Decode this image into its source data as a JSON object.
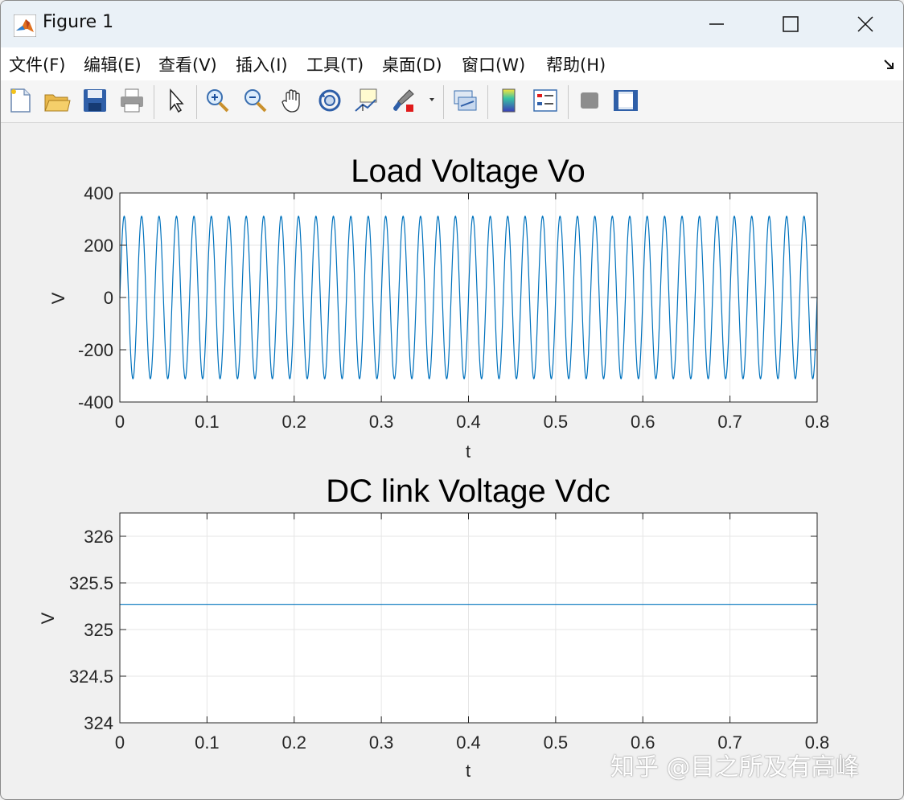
{
  "window": {
    "title": "Figure 1"
  },
  "menu": {
    "items": [
      "文件(F)",
      "编辑(E)",
      "查看(V)",
      "插入(I)",
      "工具(T)",
      "桌面(D)",
      "窗口(W)",
      "帮助(H)"
    ]
  },
  "toolbar": {
    "icons": [
      "new-figure-icon",
      "open-icon",
      "save-icon",
      "print-icon",
      "pointer-icon",
      "zoom-in-icon",
      "zoom-out-icon",
      "pan-icon",
      "rotate-3d-icon",
      "data-cursor-icon",
      "brush-icon",
      "link-plot-icon",
      "colorbar-icon",
      "legend-icon",
      "hide-plot-tools-icon",
      "show-plot-tools-icon"
    ]
  },
  "colors": {
    "line": "#0072bd",
    "grid": "#e6e6e6",
    "axes_bg": "#ffffff",
    "figure_bg": "#f0f0f0"
  },
  "watermark": "知乎 @目之所及有高峰",
  "chart_data": [
    {
      "type": "line",
      "title": "Load Voltage Vo",
      "xlabel": "t",
      "ylabel": "V",
      "xlim": [
        0,
        0.8
      ],
      "ylim": [
        -400,
        400
      ],
      "xticks": [
        0,
        0.1,
        0.2,
        0.3,
        0.4,
        0.5,
        0.6,
        0.7,
        0.8
      ],
      "yticks": [
        -400,
        -200,
        0,
        200,
        400
      ],
      "xticklabels": [
        "0",
        "0.1",
        "0.2",
        "0.3",
        "0.4",
        "0.5",
        "0.6",
        "0.7",
        "0.8"
      ],
      "yticklabels": [
        "-400",
        "-200",
        "0",
        "200",
        "400"
      ],
      "grid": true,
      "series": [
        {
          "amplitude": 311,
          "frequency_hz": 50,
          "phase": 0,
          "t_start": 0,
          "t_end": 0.8,
          "samples": 3200
        }
      ]
    },
    {
      "type": "line",
      "title": "DC link Voltage Vdc",
      "xlabel": "t",
      "ylabel": "V",
      "xlim": [
        0,
        0.8
      ],
      "ylim": [
        324,
        326.25
      ],
      "xticks": [
        0,
        0.1,
        0.2,
        0.3,
        0.4,
        0.5,
        0.6,
        0.7,
        0.8
      ],
      "yticks": [
        324,
        324.5,
        325,
        325.5,
        326
      ],
      "xticklabels": [
        "0",
        "0.1",
        "0.2",
        "0.3",
        "0.4",
        "0.5",
        "0.6",
        "0.7",
        "0.8"
      ],
      "yticklabels": [
        "324",
        "324.5",
        "325",
        "325.5",
        "326"
      ],
      "grid": true,
      "series": [
        {
          "x": [
            0,
            0.8
          ],
          "y": [
            325.27,
            325.27
          ]
        }
      ]
    }
  ]
}
